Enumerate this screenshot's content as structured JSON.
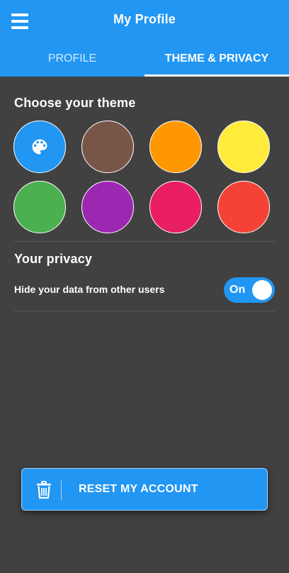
{
  "app": {
    "title": "My Profile"
  },
  "tabs": [
    {
      "label": "PROFILE",
      "active": false
    },
    {
      "label": "THEME & PRIVACY",
      "active": true
    }
  ],
  "theme": {
    "heading": "Choose your theme",
    "selected": "blue",
    "swatches": [
      {
        "name": "blue",
        "color": "#2196f3",
        "icon": "palette-icon"
      },
      {
        "name": "brown",
        "color": "#795548"
      },
      {
        "name": "orange",
        "color": "#ff9800"
      },
      {
        "name": "yellow",
        "color": "#ffeb3b"
      },
      {
        "name": "green",
        "color": "#4caf50"
      },
      {
        "name": "purple",
        "color": "#9c27b0"
      },
      {
        "name": "pink",
        "color": "#e91e63"
      },
      {
        "name": "red",
        "color": "#f44336"
      }
    ]
  },
  "privacy": {
    "heading": "Your privacy",
    "hide_data_label": "Hide your data from other users",
    "toggle_label": "On",
    "toggle_on": true
  },
  "reset": {
    "label": "RESET MY ACCOUNT",
    "icon": "trash-icon"
  },
  "colors": {
    "accent": "#2196f3",
    "background": "#414141"
  }
}
